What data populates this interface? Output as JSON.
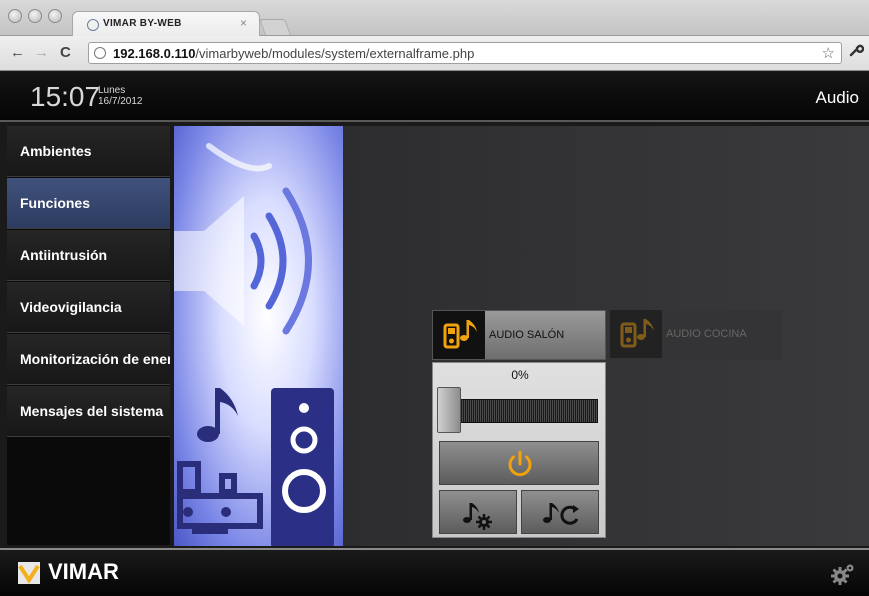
{
  "browser": {
    "tab_title": "VIMAR BY-WEB",
    "tab_close": "×",
    "url_host": "192.168.0.110",
    "url_path": "/vimarbyweb/modules/system/externalframe.php"
  },
  "header": {
    "time": "15:07",
    "day": "Lunes",
    "date": "16/7/2012",
    "section": "Audio"
  },
  "sidebar": {
    "items": [
      {
        "label": "Ambientes",
        "active": false
      },
      {
        "label": "Funciones",
        "active": true
      },
      {
        "label": "Antiintrusión",
        "active": false
      },
      {
        "label": "Videovigilancia",
        "active": false
      },
      {
        "label": "Monitorización de energía",
        "active": false
      },
      {
        "label": "Mensajes del sistema",
        "active": false
      }
    ]
  },
  "audio": {
    "zones": [
      {
        "label": "AUDIO SALÓN",
        "selected": true
      },
      {
        "label": "AUDIO COCINA",
        "selected": false
      }
    ],
    "volume_text": "0%",
    "volume_level": 0,
    "icons": [
      "music-player-icon",
      "power-icon",
      "music-settings-icon",
      "music-repeat-icon",
      "gears-icon"
    ]
  },
  "colors": {
    "accent_orange": "#f2a20c",
    "active_nav": "#3a4a72"
  },
  "footer": {
    "brand": "VIMAR"
  }
}
